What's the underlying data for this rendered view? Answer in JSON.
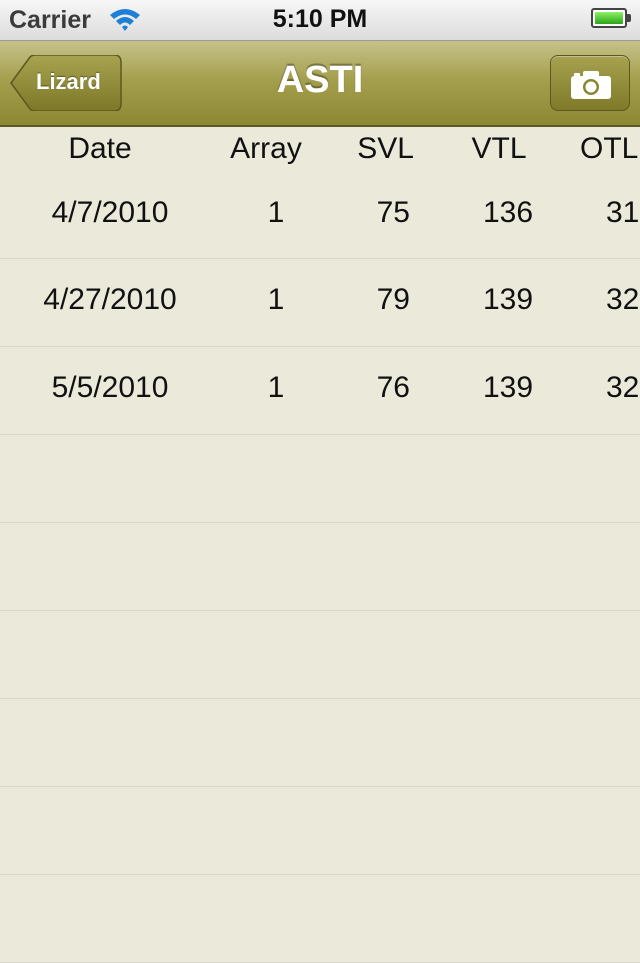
{
  "status_bar": {
    "carrier": "Carrier",
    "time": "5:10 PM",
    "battery_level": 1.0
  },
  "nav_bar": {
    "title": "ASTI",
    "back_label": "Lizard",
    "right_icon": "camera-icon",
    "tint": "#a19c4a"
  },
  "table": {
    "headers": [
      "Date",
      "Array",
      "SVL",
      "VTL",
      "OTL"
    ],
    "rows": [
      {
        "date": "4/7/2010",
        "array": "1",
        "svl": "75",
        "vtl": "136",
        "otl": "31"
      },
      {
        "date": "4/27/2010",
        "array": "1",
        "svl": "79",
        "vtl": "139",
        "otl": "32"
      },
      {
        "date": "5/5/2010",
        "array": "1",
        "svl": "76",
        "vtl": "139",
        "otl": "32"
      }
    ],
    "empty_rows": 6
  }
}
